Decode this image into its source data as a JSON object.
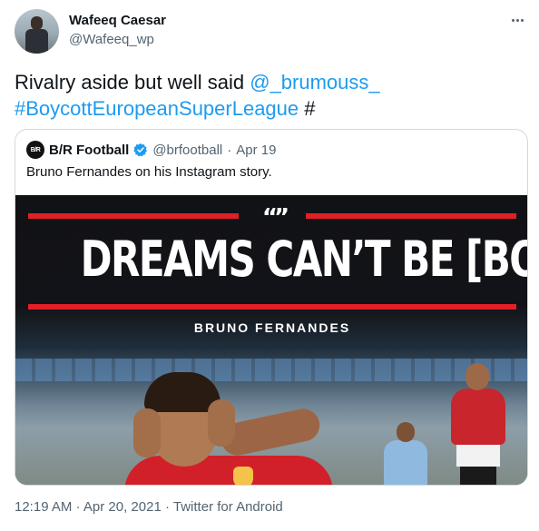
{
  "tweet": {
    "author_name": "Wafeeq Caesar",
    "author_handle": "@Wafeeq_wp",
    "text_plain_1": "Rivalry aside but well said ",
    "mention": "@_brumouss_",
    "hashtag": "#BoycottEuropeanSuperLeague",
    "hashtag_link": "#",
    "timestamp": "12:19 AM",
    "date": "Apr 20, 2021",
    "source": "Twitter for Android",
    "meta_separator": "·"
  },
  "quoted_tweet": {
    "avatar_text": "B/R",
    "author_name": "B/R Football",
    "author_handle": "@brfootball",
    "separator": "·",
    "date": "Apr 19",
    "text": "Bruno Fernandes on his Instagram story.",
    "media": {
      "quote_marks": "“”",
      "headline": "DREAMS CAN’T BE [BOUGHT]",
      "byline": "BRUNO FERNANDES"
    }
  },
  "colors": {
    "link": "#1d9bf0",
    "secondary_text": "#536471",
    "accent_red": "#e21f26",
    "verified_blue": "#1d9bf0"
  },
  "icons": [
    "more-icon",
    "verified-icon"
  ]
}
